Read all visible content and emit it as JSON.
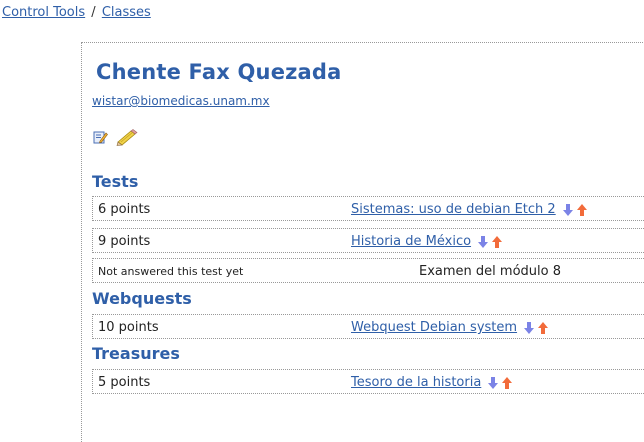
{
  "breadcrumb": {
    "parent": "Control Tools",
    "separator": "/",
    "current": "Classes"
  },
  "student": {
    "name": "Chente Fax Quezada",
    "email": "wistar@biomedicas.unam.mx"
  },
  "actions": [
    {
      "icon": "edit-icon"
    },
    {
      "icon": "pencil-icon"
    }
  ],
  "sections": {
    "tests": {
      "title": "Tests",
      "rows": [
        {
          "points": "6 points",
          "item": "Sistemas: uso de debian Etch 2",
          "link": true
        },
        {
          "points": "9 points",
          "item": "Historia de México",
          "link": true
        },
        {
          "points": "Not answered this test yet",
          "item": "Examen del módulo 8",
          "link": false
        }
      ]
    },
    "webquests": {
      "title": "Webquests",
      "rows": [
        {
          "points": "10 points",
          "item": "Webquest Debian system",
          "link": true
        }
      ]
    },
    "treasures": {
      "title": "Treasures",
      "rows": [
        {
          "points": "5 points",
          "item": "Tesoro de la historia",
          "link": true
        }
      ]
    }
  },
  "colors": {
    "accent": "#2f5fa8",
    "arrow_down": "#7b83e6",
    "arrow_up": "#f26b3a"
  }
}
